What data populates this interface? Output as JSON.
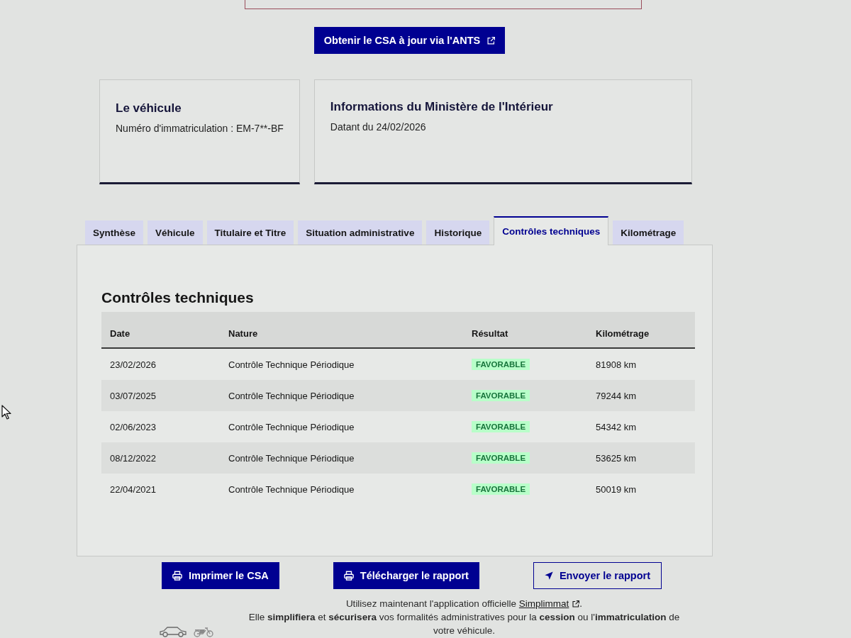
{
  "ants_button": {
    "label": "Obtenir le CSA à jour via l'ANTS"
  },
  "cards": [
    {
      "title": "Le véhicule",
      "text": "Numéro d'immatriculation : EM-7**-BF"
    },
    {
      "title": "Informations du Ministère de l'Intérieur",
      "text": "Datant du 24/02/2026"
    }
  ],
  "tabs": [
    {
      "label": "Synthèse",
      "selected": false
    },
    {
      "label": "Véhicule",
      "selected": false
    },
    {
      "label": "Titulaire et Titre",
      "selected": false
    },
    {
      "label": "Situation administrative",
      "selected": false
    },
    {
      "label": "Historique",
      "selected": false
    },
    {
      "label": "Contrôles techniques",
      "selected": true
    },
    {
      "label": "Kilométrage",
      "selected": false
    }
  ],
  "panel": {
    "title": "Contrôles techniques",
    "table": {
      "columns": [
        "Date",
        "Nature",
        "Résultat",
        "Kilométrage"
      ],
      "rows": [
        {
          "date": "23/02/2026",
          "nature": "Contrôle Technique Périodique",
          "result": "FAVORABLE",
          "mileage": "81908 km"
        },
        {
          "date": "03/07/2025",
          "nature": "Contrôle Technique Périodique",
          "result": "FAVORABLE",
          "mileage": "79244 km"
        },
        {
          "date": "02/06/2023",
          "nature": "Contrôle Technique Périodique",
          "result": "FAVORABLE",
          "mileage": "54342 km"
        },
        {
          "date": "08/12/2022",
          "nature": "Contrôle Technique Périodique",
          "result": "FAVORABLE",
          "mileage": "53625 km"
        },
        {
          "date": "22/04/2021",
          "nature": "Contrôle Technique Périodique",
          "result": "FAVORABLE",
          "mileage": "50019 km"
        }
      ]
    }
  },
  "actions": [
    {
      "label": "Imprimer le CSA",
      "kind": "primary"
    },
    {
      "label": "Télécharger le rapport",
      "kind": "primary"
    },
    {
      "label": "Envoyer le rapport",
      "kind": "secondary"
    }
  ],
  "notice": {
    "intro": "Utilisez maintenant l'application officielle",
    "link": "Simplimmat",
    "end": ".",
    "text": "Elle **simplifiera** et **sécurisera** vos formalités administratives pour la **cession** ou l'**immatriculation** de votre véhicule."
  }
}
